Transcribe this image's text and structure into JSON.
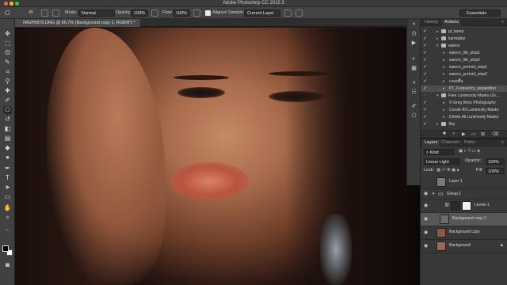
{
  "app": {
    "title": "Adobe Photoshop CC 2015.5"
  },
  "window_controls": [
    "close",
    "minimize",
    "zoom"
  ],
  "options_bar": {
    "brush_size": "45",
    "mode_label": "Mode:",
    "mode_value": "Normal",
    "opacity_label": "Opacity:",
    "opacity_value": "100%",
    "flow_label": "Flow:",
    "flow_value": "100%",
    "aligned_label": "Aligned",
    "aligned_checked": true,
    "sample_label": "Sample:",
    "sample_value": "Current Layer",
    "workspace": "Essentials"
  },
  "document": {
    "tab_title": "IMGP5878.DNG @ 66.7% (Background copy 2, RGB/8*) *"
  },
  "toolbar": {
    "tools": [
      "move-tool",
      "marquee-tool",
      "lasso-tool",
      "quick-select-tool",
      "crop-tool",
      "eyedropper-tool",
      "healing-tool",
      "brush-tool",
      "clone-stamp-tool",
      "history-brush-tool",
      "eraser-tool",
      "gradient-tool",
      "blur-tool",
      "dodge-tool",
      "pen-tool",
      "type-tool",
      "path-select-tool",
      "rectangle-tool",
      "hand-tool",
      "zoom-tool"
    ],
    "foreground_color": "#000000",
    "background_color": "#ffffff"
  },
  "actions_panel": {
    "tabs": [
      "History",
      "Actions"
    ],
    "active_tab": "Actions",
    "items": [
      {
        "label": "pt_lanna",
        "type": "folder",
        "checked": true
      },
      {
        "label": "kamtaklai",
        "type": "folder",
        "checked": true
      },
      {
        "label": "wanon",
        "type": "folder",
        "checked": true,
        "expanded": true
      },
      {
        "label": "wanon_life_step1",
        "type": "action",
        "checked": true
      },
      {
        "label": "wanon_life_step2",
        "type": "action",
        "checked": true
      },
      {
        "label": "wanon_portrait_step1",
        "type": "action",
        "checked": true
      },
      {
        "label": "wanon_portrait_step2",
        "type": "action",
        "checked": true
      },
      {
        "label": "เบลอพื้น",
        "type": "action",
        "checked": true
      },
      {
        "label": "PT_Frequency_separation",
        "type": "action",
        "checked": true,
        "selected": true
      },
      {
        "label": "Free Luminosity Masks (Gr...",
        "type": "folder",
        "checked": true,
        "red_check": true,
        "expanded": true
      },
      {
        "label": "© Greg Benz Photography",
        "type": "action",
        "checked": true
      },
      {
        "label": "Create All Luminosity Masks",
        "type": "action",
        "checked": true
      },
      {
        "label": "Delete All Luminosity Masks",
        "type": "action",
        "checked": true
      },
      {
        "label": "Sky",
        "type": "folder",
        "checked": true
      }
    ]
  },
  "layers_panel": {
    "tabs": [
      "Layers",
      "Channels",
      "Paths"
    ],
    "active_tab": "Layers",
    "filter_kind": "Kind",
    "blend_mode": "Linear Light",
    "opacity_label": "Opacity:",
    "opacity_value": "100%",
    "lock_label": "Lock:",
    "fill_label": "Fill:",
    "fill_value": "100%",
    "layers": [
      {
        "name": "Layer 1",
        "visible": false,
        "type": "pixel",
        "thumb_color": "#7a7a7a"
      },
      {
        "name": "Group 1",
        "visible": true,
        "type": "group"
      },
      {
        "name": "Levels 1",
        "visible": true,
        "type": "adjustment",
        "thumb_color": "#2a2a2a"
      },
      {
        "name": "Background copy 2",
        "visible": true,
        "type": "pixel",
        "selected": true,
        "thumb_color": "#6a6a6a"
      },
      {
        "name": "Background copy",
        "visible": true,
        "type": "pixel",
        "thumb_color": "#8a5a44"
      },
      {
        "name": "Background",
        "visible": true,
        "type": "pixel",
        "locked": true,
        "thumb_color": "#9a6a50"
      }
    ]
  }
}
